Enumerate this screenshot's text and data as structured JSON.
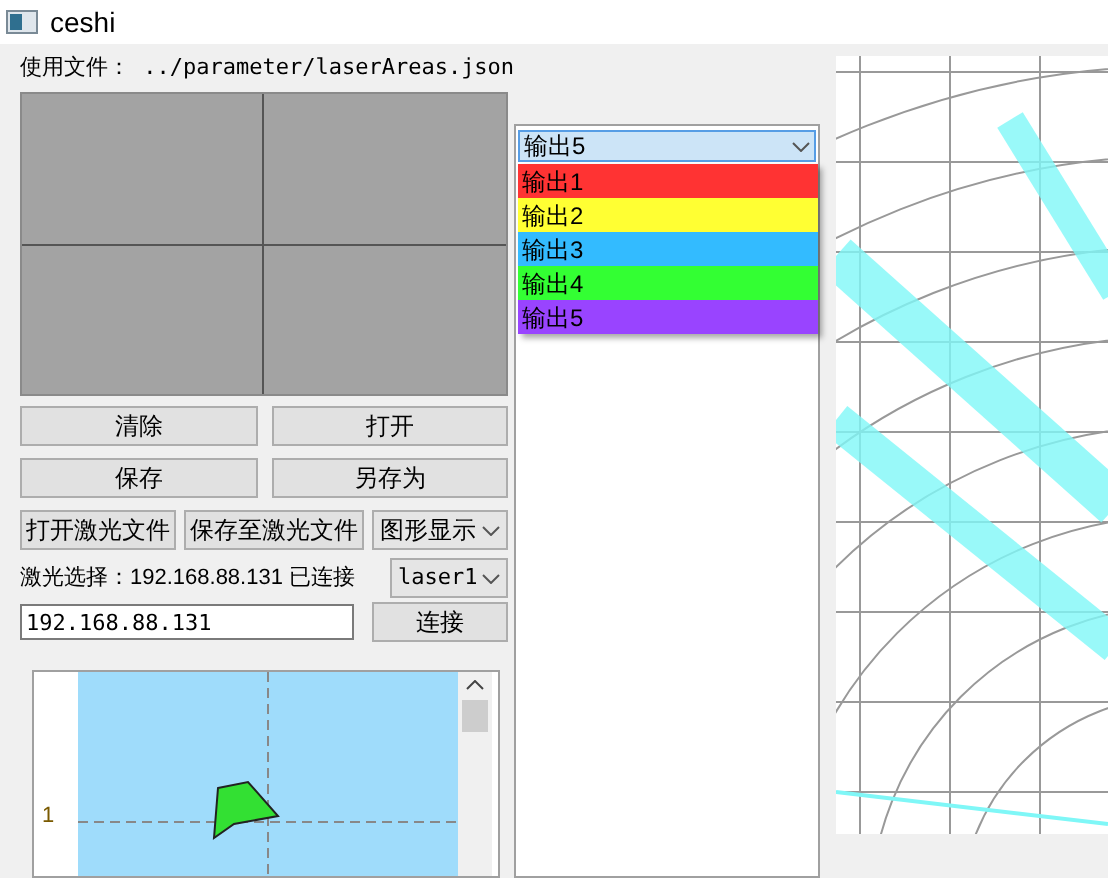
{
  "window": {
    "title": "ceshi"
  },
  "file_label": "使用文件： ../parameter/laserAreas.json",
  "buttons_row1": [
    "清除",
    "打开"
  ],
  "buttons_row2": [
    "保存",
    "另存为"
  ],
  "file_buttons": [
    "打开激光文件",
    "保存至激光文件"
  ],
  "display_select": {
    "value": "图形显示"
  },
  "laser_status": "激光选择：192.168.88.131 已连接",
  "laser_select": {
    "value": "laser1"
  },
  "ip_field": {
    "value": "192.168.88.131"
  },
  "connect_button": "连接",
  "lower_chart": {
    "row_label": "1"
  },
  "output_select": {
    "value": "输出5",
    "expanded": true,
    "options": [
      {
        "label": "输出1",
        "color": "#ff3333"
      },
      {
        "label": "输出2",
        "color": "#ffff33"
      },
      {
        "label": "输出3",
        "color": "#33bbff"
      },
      {
        "label": "输出4",
        "color": "#33ff33"
      },
      {
        "label": "输出5",
        "color": "#9944ff"
      }
    ]
  }
}
